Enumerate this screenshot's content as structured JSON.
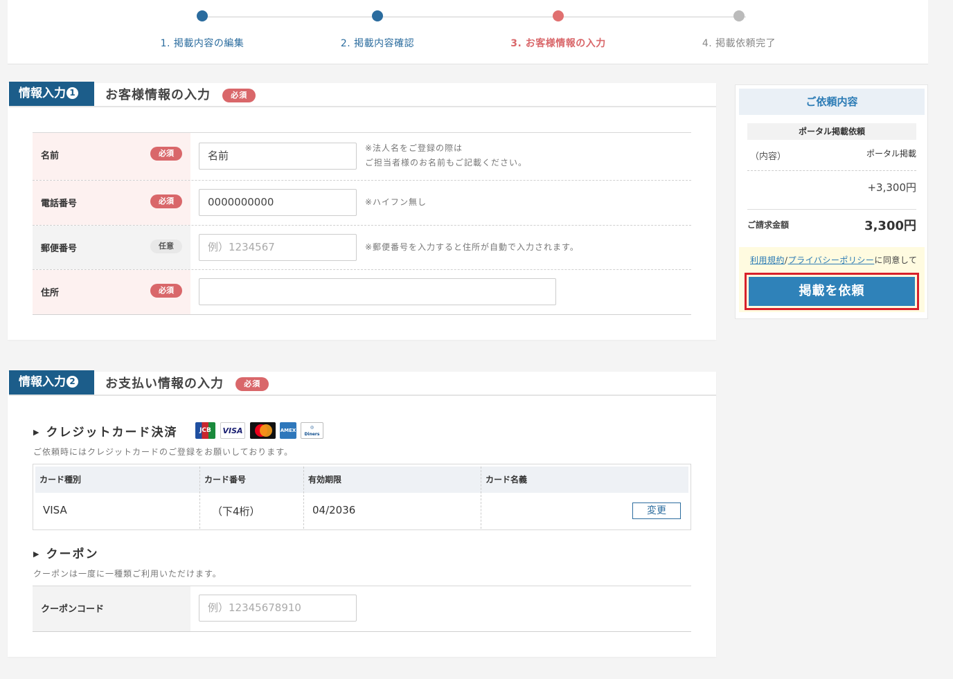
{
  "stepper": {
    "steps": [
      {
        "label": "1. 掲載内容の編集",
        "color": "#2b6c9e"
      },
      {
        "label": "2. 掲載内容確認",
        "color": "#2b6c9e"
      },
      {
        "label": "3. お客様情報の入力",
        "color": "#d9676a"
      },
      {
        "label": "4. 掲載依頼完了",
        "color": "#aaaaaa"
      }
    ]
  },
  "section1": {
    "tag": "情報入力",
    "tag_num": "1",
    "title": "お客様情報の入力",
    "required": "必須",
    "fields": [
      {
        "label": "名前",
        "badge": "必須",
        "value": "名前",
        "note": "※法人名をご登録の際は\nご担当者様のお名前もご記載ください。"
      },
      {
        "label": "電話番号",
        "badge": "必須",
        "value": "0000000000",
        "note": "※ハイフン無し"
      },
      {
        "label": "郵便番号",
        "badge": "任意",
        "placeholder": "例）1234567",
        "note": "※郵便番号を入力すると住所が自動で入力されます。"
      },
      {
        "label": "住所",
        "badge": "必須",
        "value": ""
      }
    ]
  },
  "section2": {
    "tag": "情報入力",
    "tag_num": "2",
    "title": "お支払い情報の入力",
    "required": "必須",
    "credit_heading": "クレジットカード決済",
    "credit_note": "ご依頼時にはクレジットカードのご登録をお願いしております。",
    "card_icons": [
      "JCB",
      "VISA",
      "Mastercard",
      "AMEX",
      "Diners Club"
    ],
    "card_table": {
      "headers": [
        "カード種別",
        "カード番号",
        "有効期限",
        "カード名義"
      ],
      "row": [
        "VISA",
        "（下4桁）",
        "04/2036",
        ""
      ],
      "change_label": "変更"
    },
    "coupon_heading": "クーポン",
    "coupon_note": "クーポンは一度に一種類ご利用いただけます。",
    "coupon_label": "クーポンコード",
    "coupon_placeholder": "例）12345678910"
  },
  "sidebar": {
    "title": "ご依頼内容",
    "plan": "ポータル掲載依頼",
    "content_label": "（内容）",
    "content_value": "ポータル掲載",
    "price": "+3,300円",
    "total_label": "ご請求金額",
    "total_value": "3,300円",
    "terms_link": "利用規約",
    "slash": "/",
    "privacy_link": "プライバシーポリシー",
    "agree_suffix": "に同意して",
    "cta": "掲載を依頼"
  }
}
